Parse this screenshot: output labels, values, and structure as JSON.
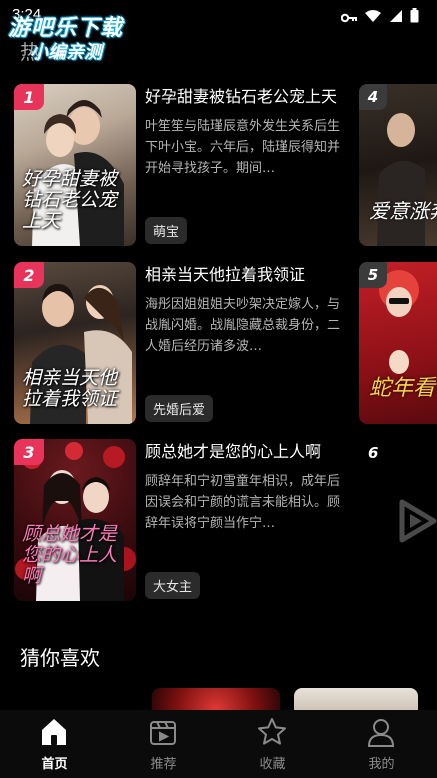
{
  "status_bar": {
    "time": "3:24",
    "icons": [
      "key-icon",
      "wifi-icon",
      "signal-icon",
      "battery-icon"
    ]
  },
  "watermark": {
    "line1": "游吧乐下载",
    "line2": "小编亲测"
  },
  "section": {
    "top_title": "热",
    "guess_title": "猜你喜欢"
  },
  "ranking": [
    {
      "rank": "1",
      "badge_color": "#e8335a",
      "title": "好孕甜妻被钻石老公宠上天",
      "description": "叶笙笙与陆瑾辰意外发生关系后生下叶小宝。六年后，陆瑾辰得知并开始寻找孩子。期间…",
      "tag": "萌宝",
      "cover_text": "好孕甜妻被钻石老公宠上天"
    },
    {
      "rank": "2",
      "badge_color": "#e8335a",
      "title": "相亲当天他拉着我领证",
      "description": "海彤因姐姐姐夫吵架决定嫁人，与战胤闪婚。战胤隐藏总裁身份，二人婚后经历诸多波…",
      "tag": "先婚后爱",
      "cover_text": "相亲当天他拉着我领证"
    },
    {
      "rank": "3",
      "badge_color": "#e8335a",
      "title": "顾总她才是您的心上人啊",
      "description": "顾辞年和宁初雪童年相识，成年后因误会和宁颜的谎言未能相认。顾辞年误将宁颜当作宁…",
      "tag": "大女主",
      "cover_text": "顾总她才是您的心上人啊"
    }
  ],
  "side_ranking": [
    {
      "rank": "4",
      "cover_text": "爱意涨奔涌"
    },
    {
      "rank": "5",
      "cover_text": "蛇年看小宝"
    },
    {
      "rank": "6"
    }
  ],
  "tabs": [
    {
      "label": "首页",
      "icon": "home-icon",
      "active": true
    },
    {
      "label": "推荐",
      "icon": "clapperboard-icon",
      "active": false
    },
    {
      "label": "收藏",
      "icon": "star-icon",
      "active": false
    },
    {
      "label": "我的",
      "icon": "user-icon",
      "active": false
    }
  ]
}
